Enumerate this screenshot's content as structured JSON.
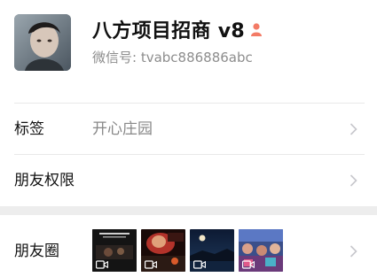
{
  "profile": {
    "name": "八方项目招商 v8",
    "wechat_id_label": "微信号: ",
    "wechat_id": "tvabc886886abc",
    "gender_icon": "female-person-icon",
    "gender_color": "#f37b66"
  },
  "rows": [
    {
      "label": "标签",
      "value": "开心庄园"
    },
    {
      "label": "朋友权限",
      "value": ""
    },
    {
      "label": "朋友圈",
      "value": ""
    }
  ],
  "moments": {
    "thumbnails": [
      {
        "icon": "video-icon",
        "theme": "dark-stage-text"
      },
      {
        "icon": "video-icon",
        "theme": "red-concert"
      },
      {
        "icon": "video-icon",
        "theme": "night-moon-sea"
      },
      {
        "icon": "video-icon",
        "theme": "colorful-crowd"
      }
    ]
  },
  "colors": {
    "secondary_text": "#888888",
    "divider": "#e9e9e9",
    "section_gap": "#ededed",
    "chevron": "#c7c7cc"
  }
}
